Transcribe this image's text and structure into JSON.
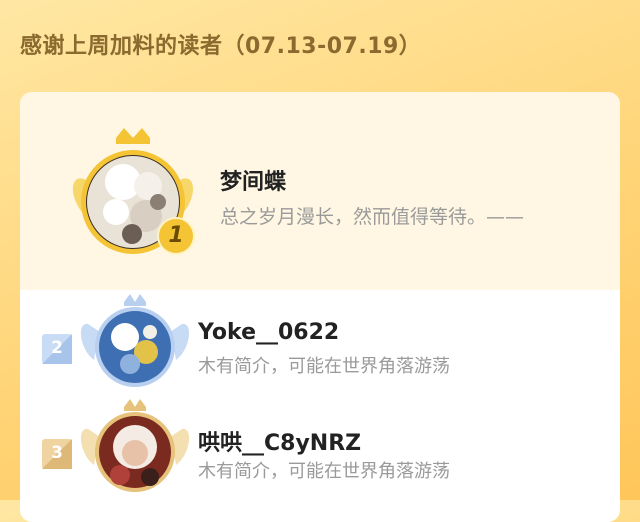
{
  "header": {
    "title": "感谢上周加料的读者（07.13-07.19）"
  },
  "top_reader": {
    "name": "梦间蝶",
    "bio": "总之岁月漫长，然而值得等待。——",
    "rank": "1"
  },
  "readers": [
    {
      "rank": "2",
      "name": "Yoke__0622",
      "bio": "木有简介，可能在世界角落游荡"
    },
    {
      "rank": "3",
      "name": "哄哄__C8yNRZ",
      "bio": "木有简介，可能在世界角落游荡"
    }
  ],
  "colors": {
    "gold": "#f4c435",
    "silver_blue": "#b8cff0",
    "bronze": "#e6c27a",
    "name_text": "#222222",
    "bio_text": "#9a9a9a"
  }
}
